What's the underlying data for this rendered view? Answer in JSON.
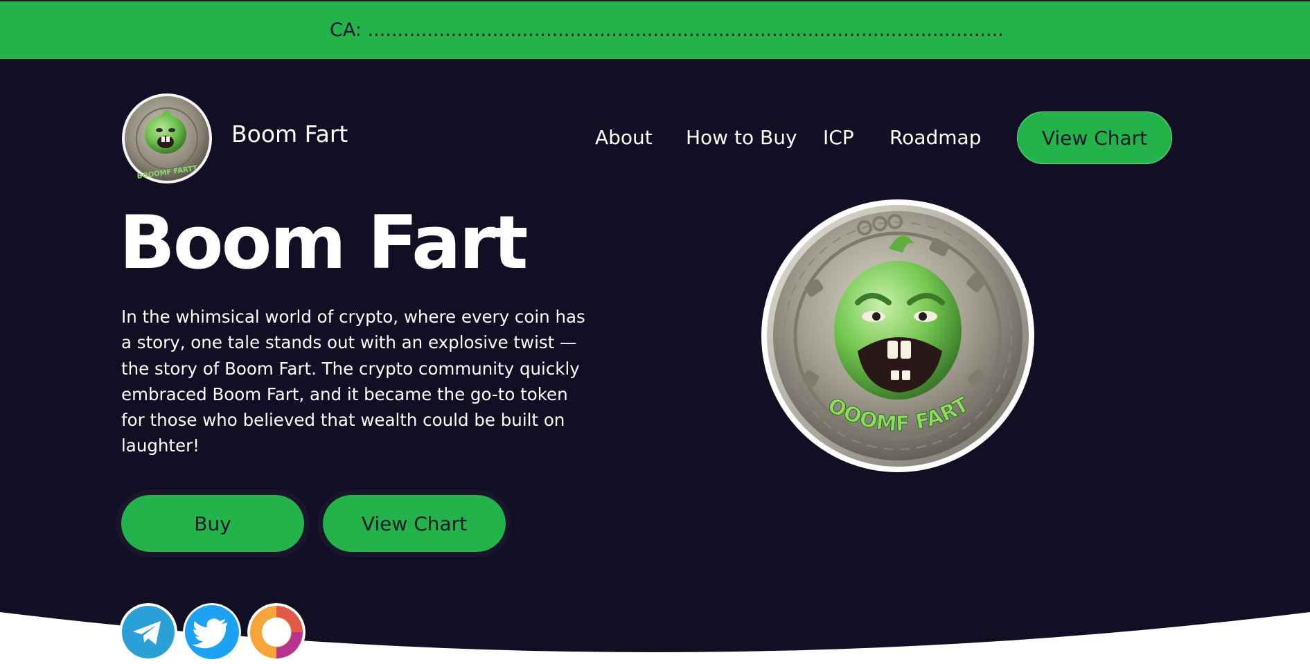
{
  "banner": {
    "ca_label": "CA: ...........................................................................................................",
    "background": "#24b24b"
  },
  "header": {
    "brand": "Boom Fart",
    "nav": [
      {
        "label": "About"
      },
      {
        "label": "How to Buy"
      },
      {
        "label": "ICP"
      },
      {
        "label": "Roadmap"
      }
    ],
    "cta_label": "View Chart"
  },
  "hero": {
    "title": "Boom Fart",
    "description": "In the whimsical world of crypto, where every coin has a story, one tale stands out with an explosive twist — the story of Boom Fart. The crypto community quickly embraced Boom Fart, and it became the go-to token for those who believed that wealth could be built on laughter!",
    "buttons": {
      "buy_label": "Buy",
      "chart_label": "View Chart"
    },
    "coin_text": "BOOOMF FARTT",
    "logo_coin_text": "BOOOMF FARTT"
  },
  "socials": [
    {
      "icon": "telegram-icon"
    },
    {
      "icon": "twitter-icon"
    },
    {
      "icon": "chart-ring-icon"
    }
  ],
  "colors": {
    "accent": "#24b24b",
    "background": "#120e24",
    "text": "#ffffff"
  }
}
